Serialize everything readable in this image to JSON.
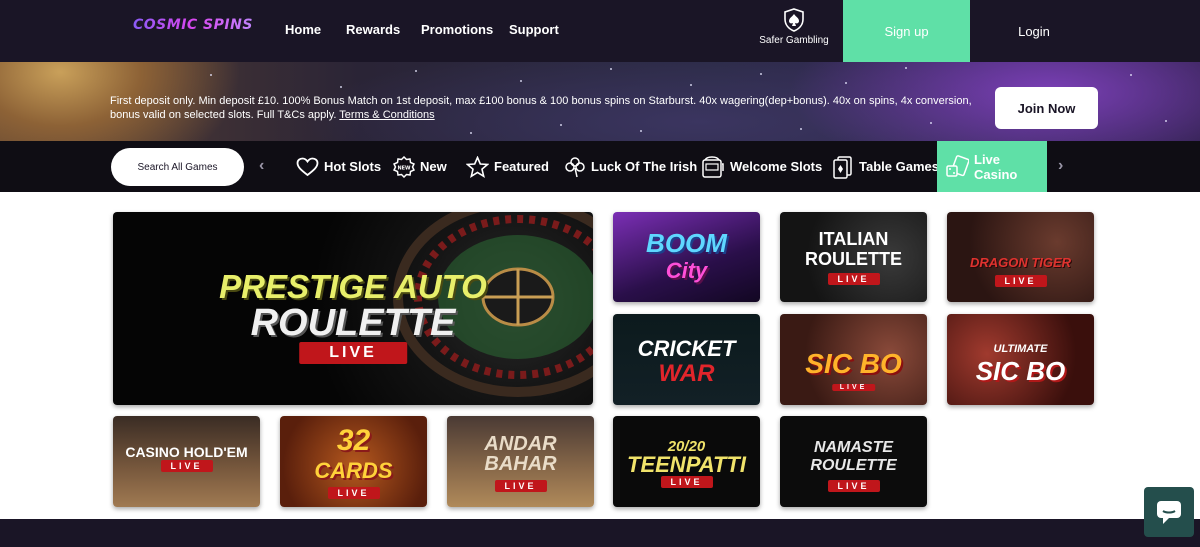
{
  "header": {
    "logo": "COSMIC SPINS",
    "nav": [
      "Home",
      "Rewards",
      "Promotions",
      "Support"
    ],
    "safer_gambling": "Safer Gambling",
    "signup": "Sign up",
    "login": "Login"
  },
  "banner": {
    "text": "First deposit only. Min deposit £10. 100% Bonus Match on 1st deposit, max £100 bonus & 100 bonus spins on Starburst. 40x wagering(dep+bonus). 40x on spins, 4x conversion, bonus valid on selected slots. Full T&Cs apply. ",
    "terms_link": "Terms & Conditions",
    "cta": "Join Now"
  },
  "categories": {
    "search_label": "Search All Games",
    "items": [
      "Hot Slots",
      "New",
      "Featured",
      "Luck Of The Irish",
      "Welcome Slots",
      "Table Games",
      "Live Casino"
    ],
    "active": "Live Casino",
    "new_badge": "NEW"
  },
  "games": [
    {
      "title_line1": "PRESTIGE AUTO",
      "title_line2": "ROULETTE",
      "tag": "LIVE"
    },
    {
      "title_line1": "BOOM",
      "title_line2": "City",
      "tag": ""
    },
    {
      "title_line1": "ITALIAN",
      "title_line2": "ROULETTE",
      "tag": "LIVE"
    },
    {
      "title_line1": "DRAGON TIGER",
      "title_line2": "",
      "tag": "LIVE"
    },
    {
      "title_line1": "CRICKET",
      "title_line2": "WAR",
      "tag": ""
    },
    {
      "title_line1": "SIC BO",
      "title_line2": "",
      "tag": "LIVE"
    },
    {
      "title_line1": "ULTIMATE",
      "title_line2": "SIC BO",
      "tag": ""
    },
    {
      "title_line1": "CASINO HOLD'EM",
      "title_line2": "",
      "tag": "LIVE"
    },
    {
      "title_line1": "32",
      "title_line2": "CARDS",
      "tag": "LIVE"
    },
    {
      "title_line1": "ANDAR",
      "title_line2": "BAHAR",
      "tag": "LIVE"
    },
    {
      "title_line1": "20/20",
      "title_line2": "TEENPATTI",
      "tag": "LIVE"
    },
    {
      "title_line1": "NAMASTE",
      "title_line2": "ROULETTE",
      "tag": "LIVE"
    }
  ],
  "colors": {
    "header_bg": "#1a1526",
    "accent_green": "#5fe0a7",
    "live_red": "#c0161b"
  }
}
